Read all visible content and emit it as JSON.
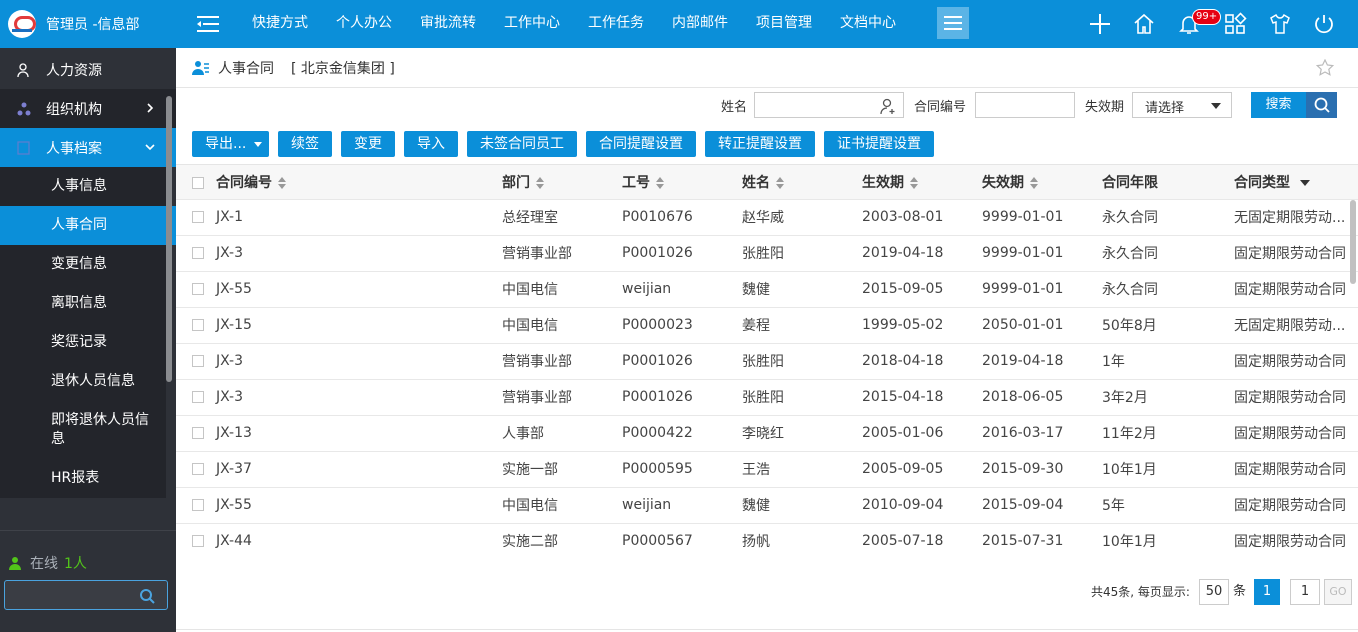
{
  "app": {
    "title": "管理员 -信息部",
    "top_nav": [
      "快捷方式",
      "个人办公",
      "审批流转",
      "工作中心",
      "工作任务",
      "内部邮件",
      "项目管理",
      "文档中心"
    ],
    "notification_badge": "99+"
  },
  "sidebar": {
    "items": [
      {
        "label": "人力资源",
        "icon": "user-icon"
      },
      {
        "label": "组织机构",
        "icon": "org-icon"
      },
      {
        "label": "人事档案",
        "icon": "archive-icon"
      }
    ],
    "sub_items": [
      "人事信息",
      "人事合同",
      "变更信息",
      "离职信息",
      "奖惩记录",
      "退休人员信息",
      "即将退休人员信息",
      "HR报表"
    ],
    "online_label": "在线",
    "online_count": "1人"
  },
  "breadcrumb": {
    "page": "人事合同",
    "org": "[ 北京金信集团 ]"
  },
  "filter": {
    "name_label": "姓名",
    "contract_no_label": "合同编号",
    "expiry_label": "失效期",
    "expiry_value": "请选择",
    "search_label": "搜索"
  },
  "toolbar": {
    "export_label": "导出...",
    "buttons": [
      "续签",
      "变更",
      "导入",
      "未签合同员工",
      "合同提醒设置",
      "转正提醒设置",
      "证书提醒设置"
    ]
  },
  "table": {
    "headers": [
      "合同编号",
      "部门",
      "工号",
      "姓名",
      "生效期",
      "失效期",
      "合同年限",
      "合同类型"
    ],
    "rows": [
      [
        "JX-1",
        "总经理室",
        "P0010676",
        "赵华威",
        "2003-08-01",
        "9999-01-01",
        "永久合同",
        "无固定期限劳动..."
      ],
      [
        "JX-3",
        "营销事业部",
        "P0001026",
        "张胜阳",
        "2019-04-18",
        "9999-01-01",
        "永久合同",
        "固定期限劳动合同"
      ],
      [
        "JX-55",
        "中国电信",
        "weijian",
        "魏健",
        "2015-09-05",
        "9999-01-01",
        "永久合同",
        "固定期限劳动合同"
      ],
      [
        "JX-15",
        "中国电信",
        "P0000023",
        "姜程",
        "1999-05-02",
        "2050-01-01",
        "50年8月",
        "无固定期限劳动..."
      ],
      [
        "JX-3",
        "营销事业部",
        "P0001026",
        "张胜阳",
        "2018-04-18",
        "2019-04-18",
        "1年",
        "固定期限劳动合同"
      ],
      [
        "JX-3",
        "营销事业部",
        "P0001026",
        "张胜阳",
        "2015-04-18",
        "2018-06-05",
        "3年2月",
        "固定期限劳动合同"
      ],
      [
        "JX-13",
        "人事部",
        "P0000422",
        "李晓红",
        "2005-01-06",
        "2016-03-17",
        "11年2月",
        "固定期限劳动合同"
      ],
      [
        "JX-37",
        "实施一部",
        "P0000595",
        "王浩",
        "2005-09-05",
        "2015-09-30",
        "10年1月",
        "固定期限劳动合同"
      ],
      [
        "JX-55",
        "中国电信",
        "weijian",
        "魏健",
        "2010-09-04",
        "2015-09-04",
        "5年",
        "固定期限劳动合同"
      ],
      [
        "JX-44",
        "实施二部",
        "P0000567",
        "扬帆",
        "2005-07-18",
        "2015-07-31",
        "10年1月",
        "固定期限劳动合同"
      ]
    ]
  },
  "pagination": {
    "summary": "共45条, 每页显示:",
    "page_size": "50",
    "unit": "条",
    "current_page": "1",
    "page_input": "1",
    "go_label": "GO"
  }
}
